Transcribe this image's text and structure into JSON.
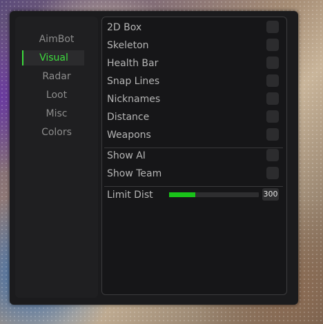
{
  "sidebar": {
    "items": [
      {
        "label": "AimBot",
        "active": false
      },
      {
        "label": "Visual",
        "active": true
      },
      {
        "label": "Radar",
        "active": false
      },
      {
        "label": "Loot",
        "active": false
      },
      {
        "label": "Misc",
        "active": false
      },
      {
        "label": "Colors",
        "active": false
      }
    ]
  },
  "visual": {
    "esp_options": [
      {
        "label": "2D Box",
        "checked": false
      },
      {
        "label": "Skeleton",
        "checked": false
      },
      {
        "label": "Health Bar",
        "checked": false
      },
      {
        "label": "Snap Lines",
        "checked": false
      },
      {
        "label": "Nicknames",
        "checked": false
      },
      {
        "label": "Distance",
        "checked": false
      },
      {
        "label": "Weapons",
        "checked": false
      }
    ],
    "filter_options": [
      {
        "label": "Show AI",
        "checked": false
      },
      {
        "label": "Show Team",
        "checked": false
      }
    ],
    "limit_dist": {
      "label": "Limit Dist",
      "value": "300",
      "fill_fraction": 0.29
    }
  },
  "colors": {
    "accent": "#3ddc3d",
    "slider_fill": "#19c219",
    "window_bg": "#1b1b1d"
  }
}
